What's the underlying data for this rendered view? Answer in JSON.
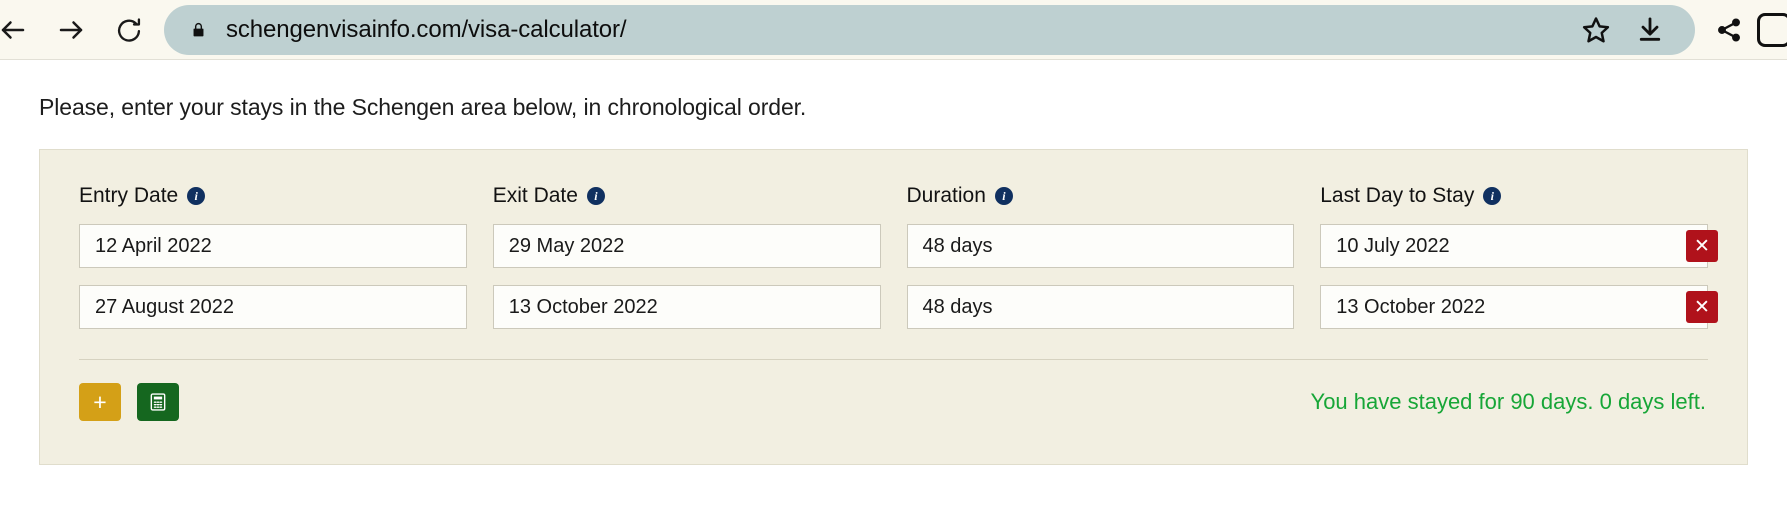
{
  "browser": {
    "back_label": "Back",
    "forward_label": "Forward",
    "reload_label": "Reload",
    "url": "schengenvisainfo.com/visa-calculator/",
    "lock_label": "Secure",
    "bookmark_label": "Bookmark",
    "download_label": "Downloads",
    "share_label": "Share",
    "tab_count": ""
  },
  "page": {
    "intro": "Please, enter your stays in the Schengen area below, in chronological order."
  },
  "calculator": {
    "columns": [
      {
        "label": "Entry Date",
        "info": "i"
      },
      {
        "label": "Exit Date",
        "info": "i"
      },
      {
        "label": "Duration",
        "info": "i"
      },
      {
        "label": "Last Day to Stay",
        "info": "i"
      }
    ],
    "rows": [
      {
        "entry_date": "12 April 2022",
        "exit_date": "29 May 2022",
        "duration": "48 days",
        "last_day": "10 July 2022",
        "delete_label": "✕"
      },
      {
        "entry_date": "27 August 2022",
        "exit_date": "13 October 2022",
        "duration": "48 days",
        "last_day": "13 October 2022",
        "delete_label": "✕"
      }
    ],
    "add_button_label": "+",
    "calculate_button_label": "calculator-icon",
    "status_text": "You have stayed for 90 days. 0 days left.",
    "colors": {
      "accent_navy": "#103060",
      "delete_red": "#b0121b",
      "add_gold": "#d4a017",
      "calc_green": "#15671f",
      "status_green": "#17a637",
      "card_bg": "#f2efe1",
      "omnibox_bg": "#bed0d1"
    }
  }
}
